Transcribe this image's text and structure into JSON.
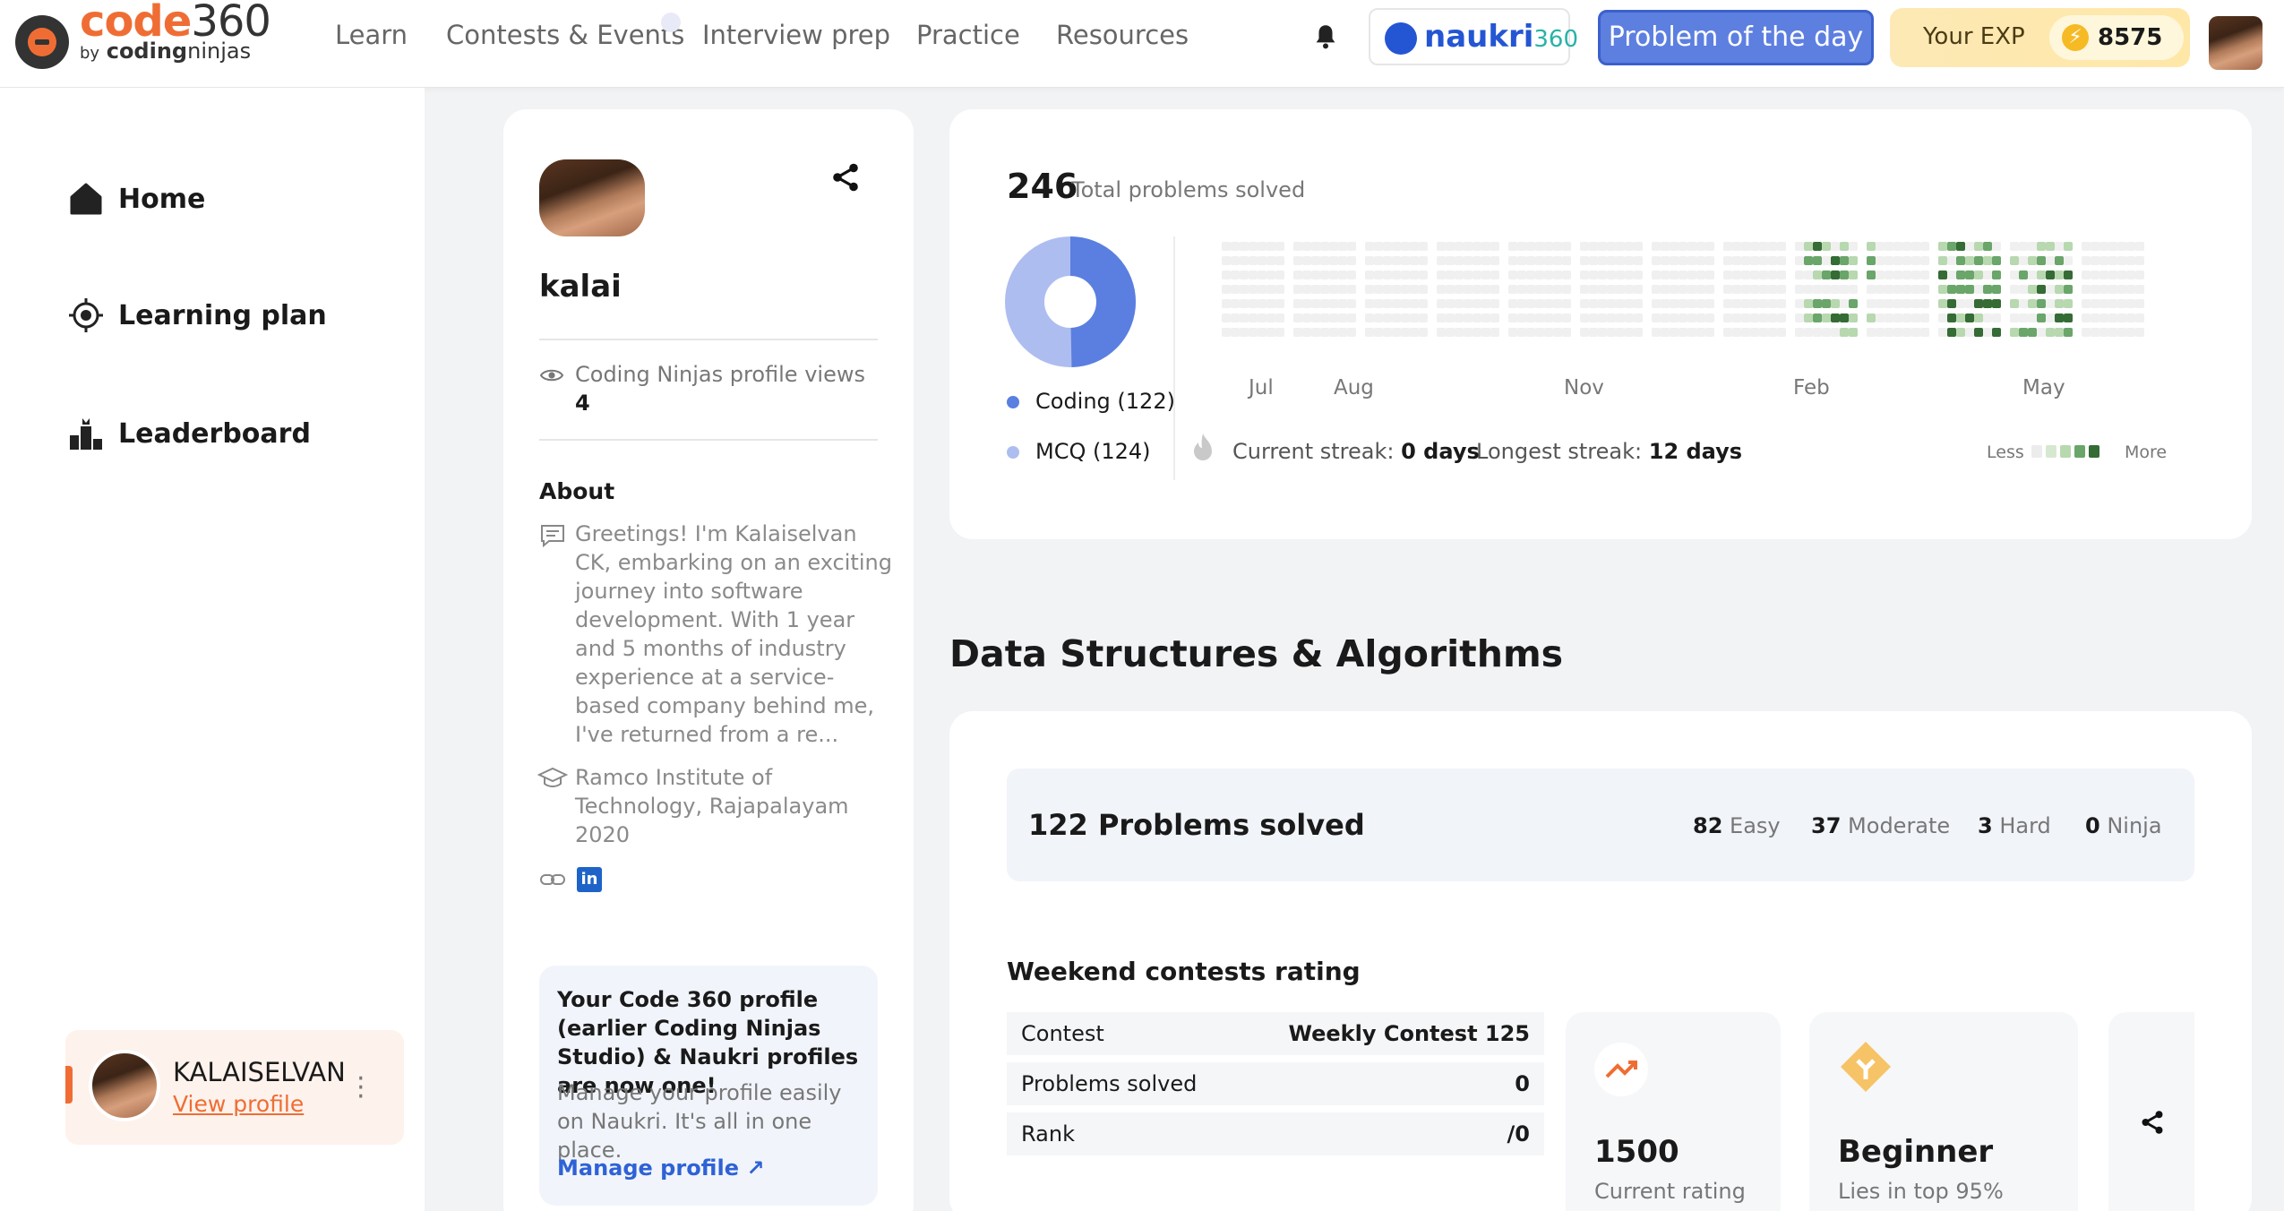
{
  "brand": {
    "name": "code",
    "num": "360",
    "by": "by",
    "org_a": "coding",
    "org_b": "ninjas"
  },
  "nav": {
    "learn": "Learn",
    "contests": "Contests & Events",
    "interview": "Interview prep",
    "practice": "Practice",
    "resources": "Resources"
  },
  "header": {
    "naukri": "naukri",
    "naukri_num": "360",
    "potd": "Problem of the day",
    "exp_label": "Your EXP",
    "exp_value": "8575"
  },
  "sidebar": {
    "items": [
      {
        "label": "Home"
      },
      {
        "label": "Learning plan"
      },
      {
        "label": "Leaderboard"
      }
    ],
    "user": {
      "name": "KALAISELVAN",
      "link": "View profile"
    }
  },
  "profile": {
    "username": "kalai",
    "views_label": "Coding Ninjas profile views",
    "views": "4",
    "about_title": "About",
    "about": "Greetings! I'm Kalaiselvan CK, embarking on an exciting journey into software development. With 1 year and 5 months of industry experience at a service-based company behind me, I've returned from a re...",
    "college": "Ramco Institute of Technology, Rajapalayam",
    "year": "2020",
    "notice_title": "Your Code 360 profile (earlier Coding Ninjas Studio) & Naukri profiles are now one!",
    "notice_body": "Manage your profile easily on Naukri. It's all in one place.",
    "manage": "Manage profile"
  },
  "summary": {
    "total": "246",
    "total_label": "Total problems solved",
    "coding": "Coding (122)",
    "mcq": "MCQ (124)",
    "coding_count": 122,
    "mcq_count": 124,
    "months": [
      "Jul",
      "Aug",
      "Nov",
      "Feb",
      "May"
    ],
    "streak_label": "Current streak:",
    "streak_value": "0 days",
    "longest_label": "Longest streak:",
    "longest_value": "12 days",
    "less": "Less",
    "more": "More"
  },
  "dsa": {
    "heading": "Data Structures & Algorithms",
    "solved": "122 Problems solved",
    "easy_n": "82",
    "easy": "Easy",
    "mod_n": "37",
    "mod": "Moderate",
    "hard_n": "3",
    "hard": "Hard",
    "ninja_n": "0",
    "ninja": "Ninja",
    "weekend_title": "Weekend contests rating",
    "rows": [
      {
        "l": "Contest",
        "r": "Weekly Contest 125"
      },
      {
        "l": "Problems solved",
        "r": "0"
      },
      {
        "l": "Rank",
        "r": "/0"
      }
    ],
    "rating": "1500",
    "rating_label": "Current rating",
    "level": "Beginner",
    "level_label": "Lies in top 95%"
  },
  "colors": {
    "accent": "#ef6d34",
    "primary": "#5d7fe0",
    "coding": "#5a7fe0",
    "mcq": "#aebdf0",
    "green_dark": "#356b35",
    "green_mid": "#6aa56a",
    "green_light": "#b8d8b0",
    "empty": "#ececec"
  }
}
